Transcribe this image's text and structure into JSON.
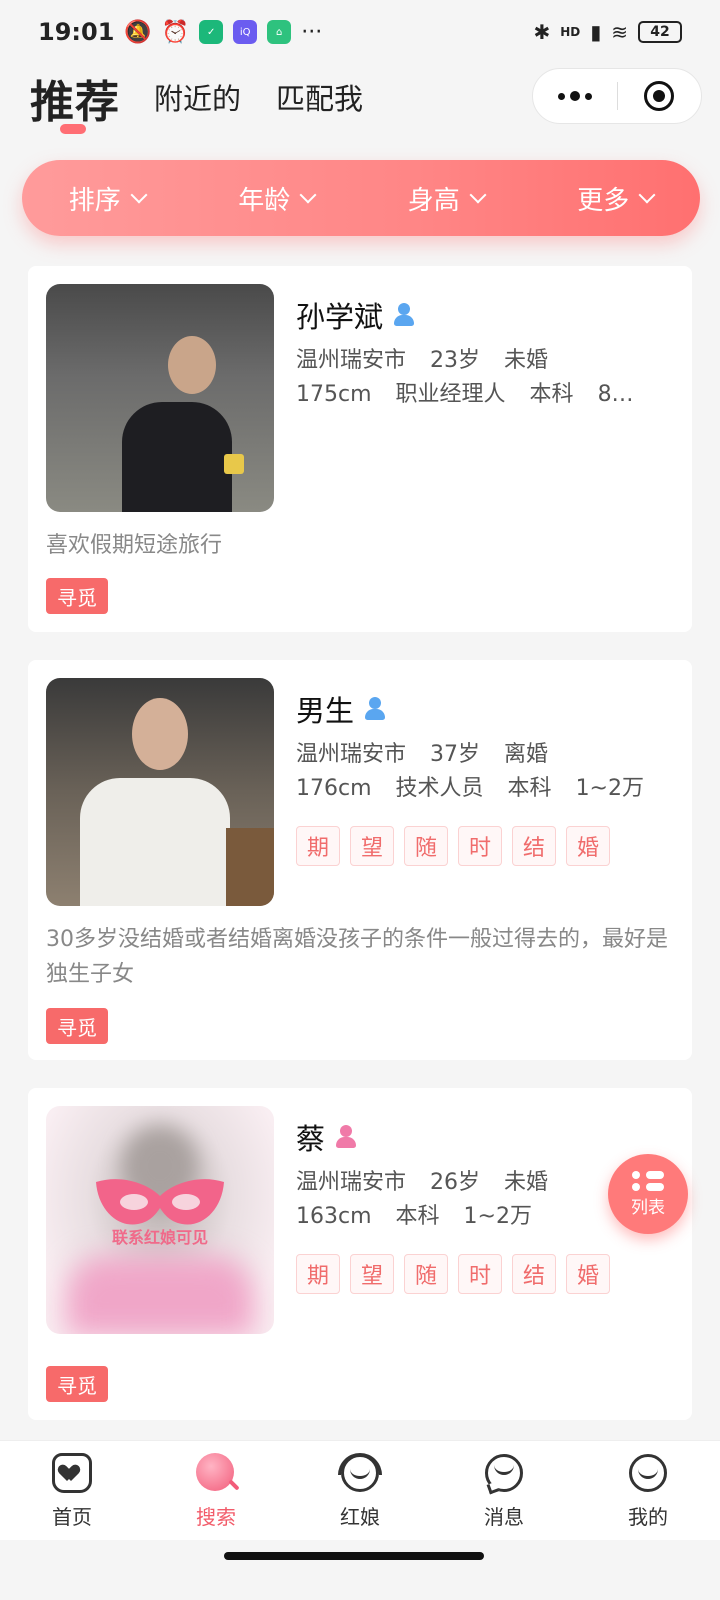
{
  "status_bar": {
    "time": "19:01",
    "more": "···",
    "network": "HD",
    "battery": "42",
    "app_icons": [
      "shield-app-icon",
      "iqiyi-app-icon",
      "home-app-icon"
    ]
  },
  "header": {
    "tabs": [
      {
        "label": "推荐",
        "active": true
      },
      {
        "label": "附近的",
        "active": false
      },
      {
        "label": "匹配我",
        "active": false
      }
    ],
    "capsule_icons": [
      "more-dots-icon",
      "close-target-icon"
    ]
  },
  "filters": [
    "排序",
    "年龄",
    "身高",
    "更多"
  ],
  "cards": [
    {
      "name": "孙学斌",
      "gender": "male",
      "line1": [
        "温州瑞安市",
        "23岁",
        "未婚"
      ],
      "line2": [
        "175cm",
        "职业经理人",
        "本科",
        "8…"
      ],
      "tags": [],
      "desc": "喜欢假期短途旅行",
      "seek_label": "寻觅"
    },
    {
      "name": "男生",
      "gender": "male",
      "line1": [
        "温州瑞安市",
        "37岁",
        "离婚"
      ],
      "line2": [
        "176cm",
        "技术人员",
        "本科",
        "1~2万"
      ],
      "tags": [
        "期",
        "望",
        "随",
        "时",
        "结",
        "婚"
      ],
      "desc": "30多岁没结婚或者结婚离婚没孩子的条件一般过得去的，最好是独生子女",
      "seek_label": "寻觅"
    },
    {
      "name": "蔡",
      "gender": "female",
      "line1": [
        "温州瑞安市",
        "26岁",
        "未婚"
      ],
      "line2": [
        "163cm",
        "本科",
        "1~2万"
      ],
      "tags": [
        "期",
        "望",
        "随",
        "时",
        "结",
        "婚"
      ],
      "photo_overlay": "联系红娘可见",
      "desc": "",
      "seek_label": "寻觅"
    }
  ],
  "float_button": {
    "label": "列表"
  },
  "bottom_nav": [
    {
      "label": "首页",
      "icon": "home-heart-icon",
      "active": false
    },
    {
      "label": "搜索",
      "icon": "search-icon",
      "active": true
    },
    {
      "label": "红娘",
      "icon": "matchmaker-headset-icon",
      "active": false
    },
    {
      "label": "消息",
      "icon": "message-bubble-icon",
      "active": false
    },
    {
      "label": "我的",
      "icon": "profile-smile-icon",
      "active": false
    }
  ],
  "colors": {
    "accent": "#f76a6a",
    "filter_gradient_start": "#ff9b9b",
    "filter_gradient_end": "#ff7070",
    "male_badge": "#5aa6f0",
    "female_badge": "#f07aa8"
  }
}
